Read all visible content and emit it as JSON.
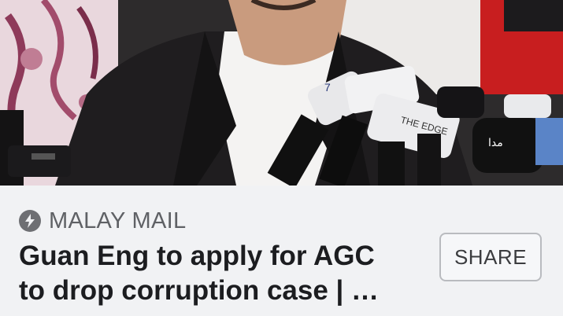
{
  "article": {
    "source": "MALAY MAIL",
    "source_icon": "bolt-icon",
    "headline_line1": "Guan Eng to apply for AGC",
    "headline_line2": "to drop corruption case | …",
    "share_label": "SHARE"
  },
  "photo": {
    "description_icon": "press-conference-photo",
    "mic_labels": [
      "7",
      "THE EDGE",
      "مدا"
    ]
  },
  "colors": {
    "background": "#f1f2f4",
    "headline": "#1c1d20",
    "source": "#5f6165",
    "button_border": "#b9bbbf"
  }
}
